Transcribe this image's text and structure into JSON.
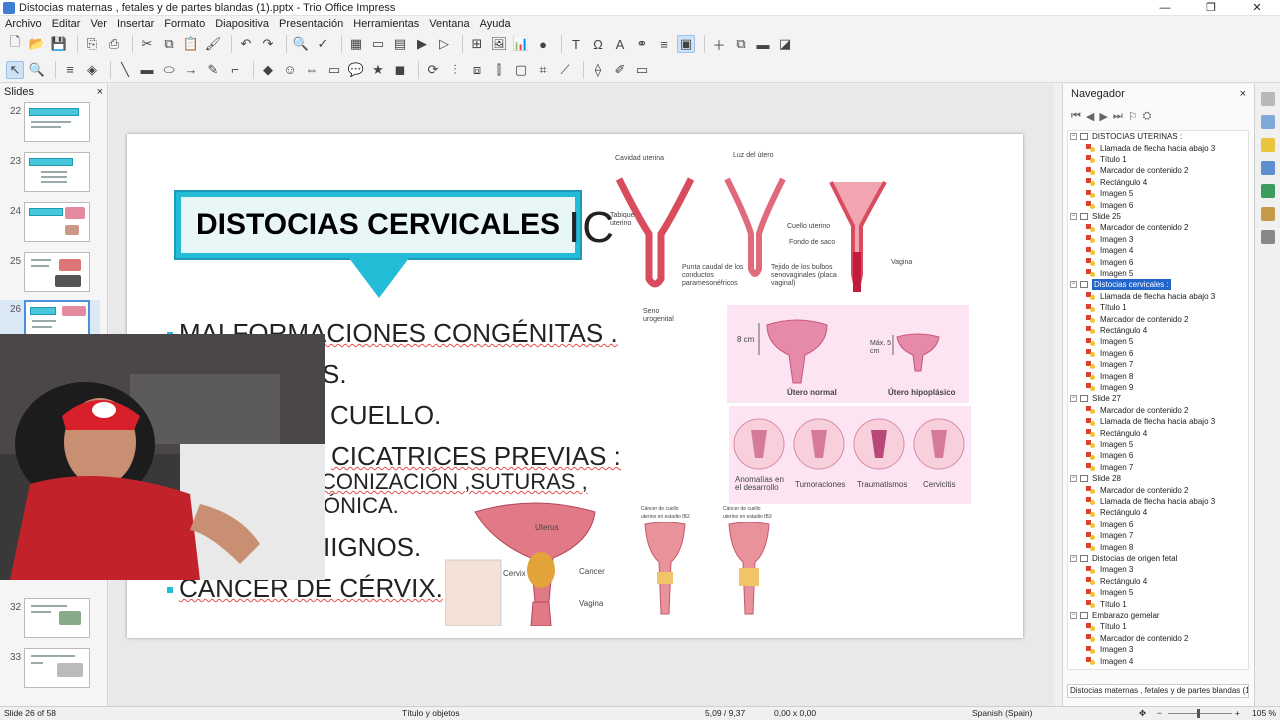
{
  "window": {
    "title": "Distocias maternas , fetales y de partes blandas (1).pptx - Trio Office Impress",
    "controls": [
      "—",
      "❐",
      "✕"
    ]
  },
  "menu": [
    "Archivo",
    "Editar",
    "Ver",
    "Insertar",
    "Formato",
    "Diapositiva",
    "Presentación",
    "Herramientas",
    "Ventana",
    "Ayuda"
  ],
  "slides_panel": {
    "title": "Slides",
    "close": "×",
    "thumbs": [
      {
        "num": "22"
      },
      {
        "num": "23"
      },
      {
        "num": "24"
      },
      {
        "num": "25"
      },
      {
        "num": "26"
      },
      {
        "num": "32"
      },
      {
        "num": "33"
      }
    ]
  },
  "slide": {
    "title": "DISTOCIAS CERVICALES",
    "overlay_letters": "IC",
    "bullets": [
      "MALFORMACIONES CONGÉNITAS .",
      "S.",
      "CUELLO.",
      "CICATRICES PREVIAS :",
      "CONIZACIÓN ,SUTURAS ,",
      "ÓNICA.",
      "IIGNOS.",
      "CÁNCER DE CÉRVIX."
    ],
    "figure_labels": {
      "cavidad": "Cavidad uterina",
      "luz": "Luz del útero",
      "tabique": "Tabique uterino",
      "cuello": "Cuello uterino",
      "fondo": "Fondo de saco",
      "vagina": "Vagina",
      "punta": "Punta caudal de los conductos paramesonéfricos",
      "tejido": "Tejido de los bulbos senovaginales (placa vaginal)",
      "seno": "Seno urogenital",
      "cm8": "8 cm",
      "max5": "Máx. 5 cm",
      "normal": "Útero normal",
      "hipo": "Útero hipoplásico",
      "anom": "Anomalías en el desarrollo",
      "tumor": "Tumoraciones",
      "trauma": "Traumatismos",
      "cervicitis": "Cervicitis",
      "uterus": "Uterus",
      "cervix": "Cervix",
      "cancer": "Cancer",
      "vagina2": "Vagina",
      "cancer_ib2": "Cáncer de cuello uterino en estadio IB2",
      "cancer_ib3": "Cáncer de cuello uterino en estadio IB3"
    }
  },
  "navigator": {
    "title": "Navegador",
    "close": "×",
    "tree": [
      {
        "head": "DISTOCIAS UTERINAS :",
        "sel": false,
        "items": [
          "Llamada de flecha hacia abajo 3",
          "Título 1",
          "Marcador de contenido 2",
          "Rectángulo 4",
          "Imagen 5",
          "Imagen 6"
        ]
      },
      {
        "head": "Slide 25",
        "sel": false,
        "items": [
          "Marcador de contenido 2",
          "Imagen 3",
          "Imagen 4",
          "Imagen 6",
          "Imagen 5"
        ]
      },
      {
        "head": "Distocias cervicales :",
        "sel": true,
        "items": [
          "Llamada de flecha hacia abajo 3",
          "Título 1",
          "Marcador de contenido 2",
          "Rectángulo 4",
          "Imagen 5",
          "Imagen 6",
          "Imagen 7",
          "Imagen 8",
          "Imagen 9"
        ]
      },
      {
        "head": "Slide 27",
        "sel": false,
        "items": [
          "Marcador de contenido 2",
          "Llamada de flecha hacia abajo 3",
          "Rectángulo 4",
          "Imagen 5",
          "Imagen 6",
          "Imagen 7"
        ]
      },
      {
        "head": "Slide 28",
        "sel": false,
        "items": [
          "Marcador de contenido 2",
          "Llamada de flecha hacia abajo 3",
          "Rectángulo 4",
          "Imagen 6",
          "Imagen 7",
          "Imagen 8"
        ]
      },
      {
        "head": "Distocias de origen fetal",
        "sel": false,
        "items": [
          "Imagen 3",
          "Rectángulo 4",
          "Imagen 5",
          "Título 1"
        ]
      },
      {
        "head": "Embarazo gemelar",
        "sel": false,
        "items": [
          "Título 1",
          "Marcador de contenido 2",
          "Imagen 3",
          "Imagen 4"
        ]
      }
    ],
    "document": "Distocias maternas , fetales y de partes blandas (1)"
  },
  "status": {
    "slide": "Slide 26 of 58",
    "layout": "Título y objetos",
    "position": "5,09 / 9,37",
    "size": "0,00 x 0,00",
    "language": "Spanish (Spain)",
    "zoom": "105 %"
  },
  "colors": {
    "accent_cyan": "#22bcd7",
    "pink_panel": "#fce4f3",
    "selection": "#2266cc"
  }
}
